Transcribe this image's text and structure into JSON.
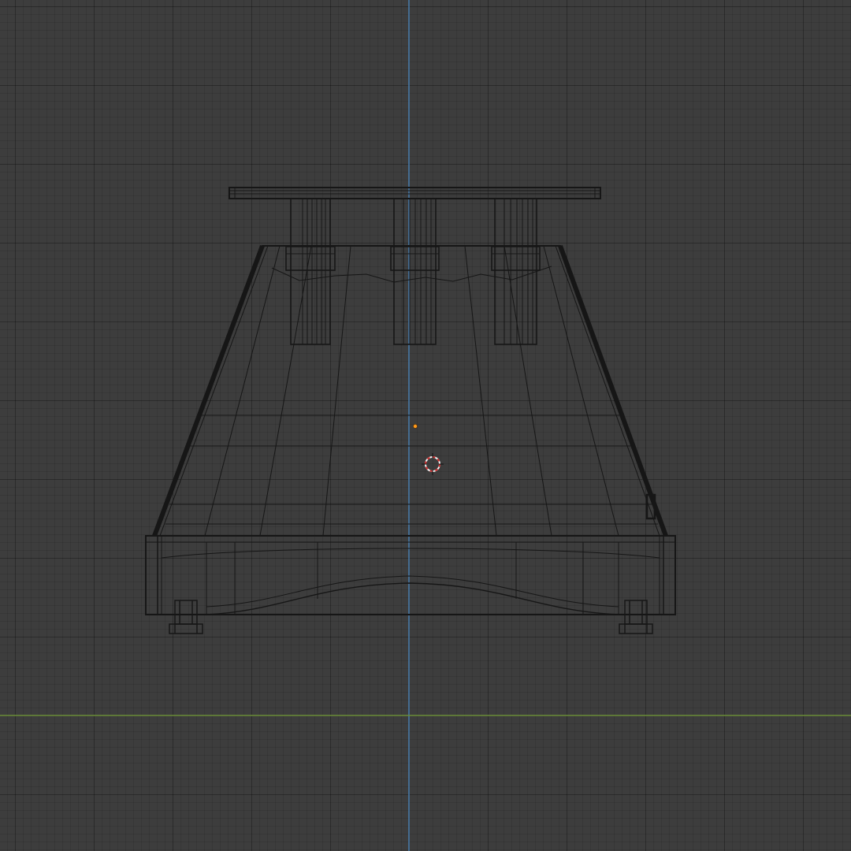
{
  "viewport": {
    "background_color": "#3d3d3d",
    "grid_color": "#353535",
    "axis_z_color": "#4a7fb0",
    "axis_y_color": "#6c8f3a",
    "wire_color": "#161616",
    "origin_color": "#ff9a1a",
    "cursor_colors": [
      "#d12a2a",
      "#f2f2f2"
    ]
  },
  "objects": [
    "top-plate",
    "support-post",
    "support-post",
    "support-post",
    "trapezoid-body",
    "base-block",
    "foot",
    "foot"
  ]
}
